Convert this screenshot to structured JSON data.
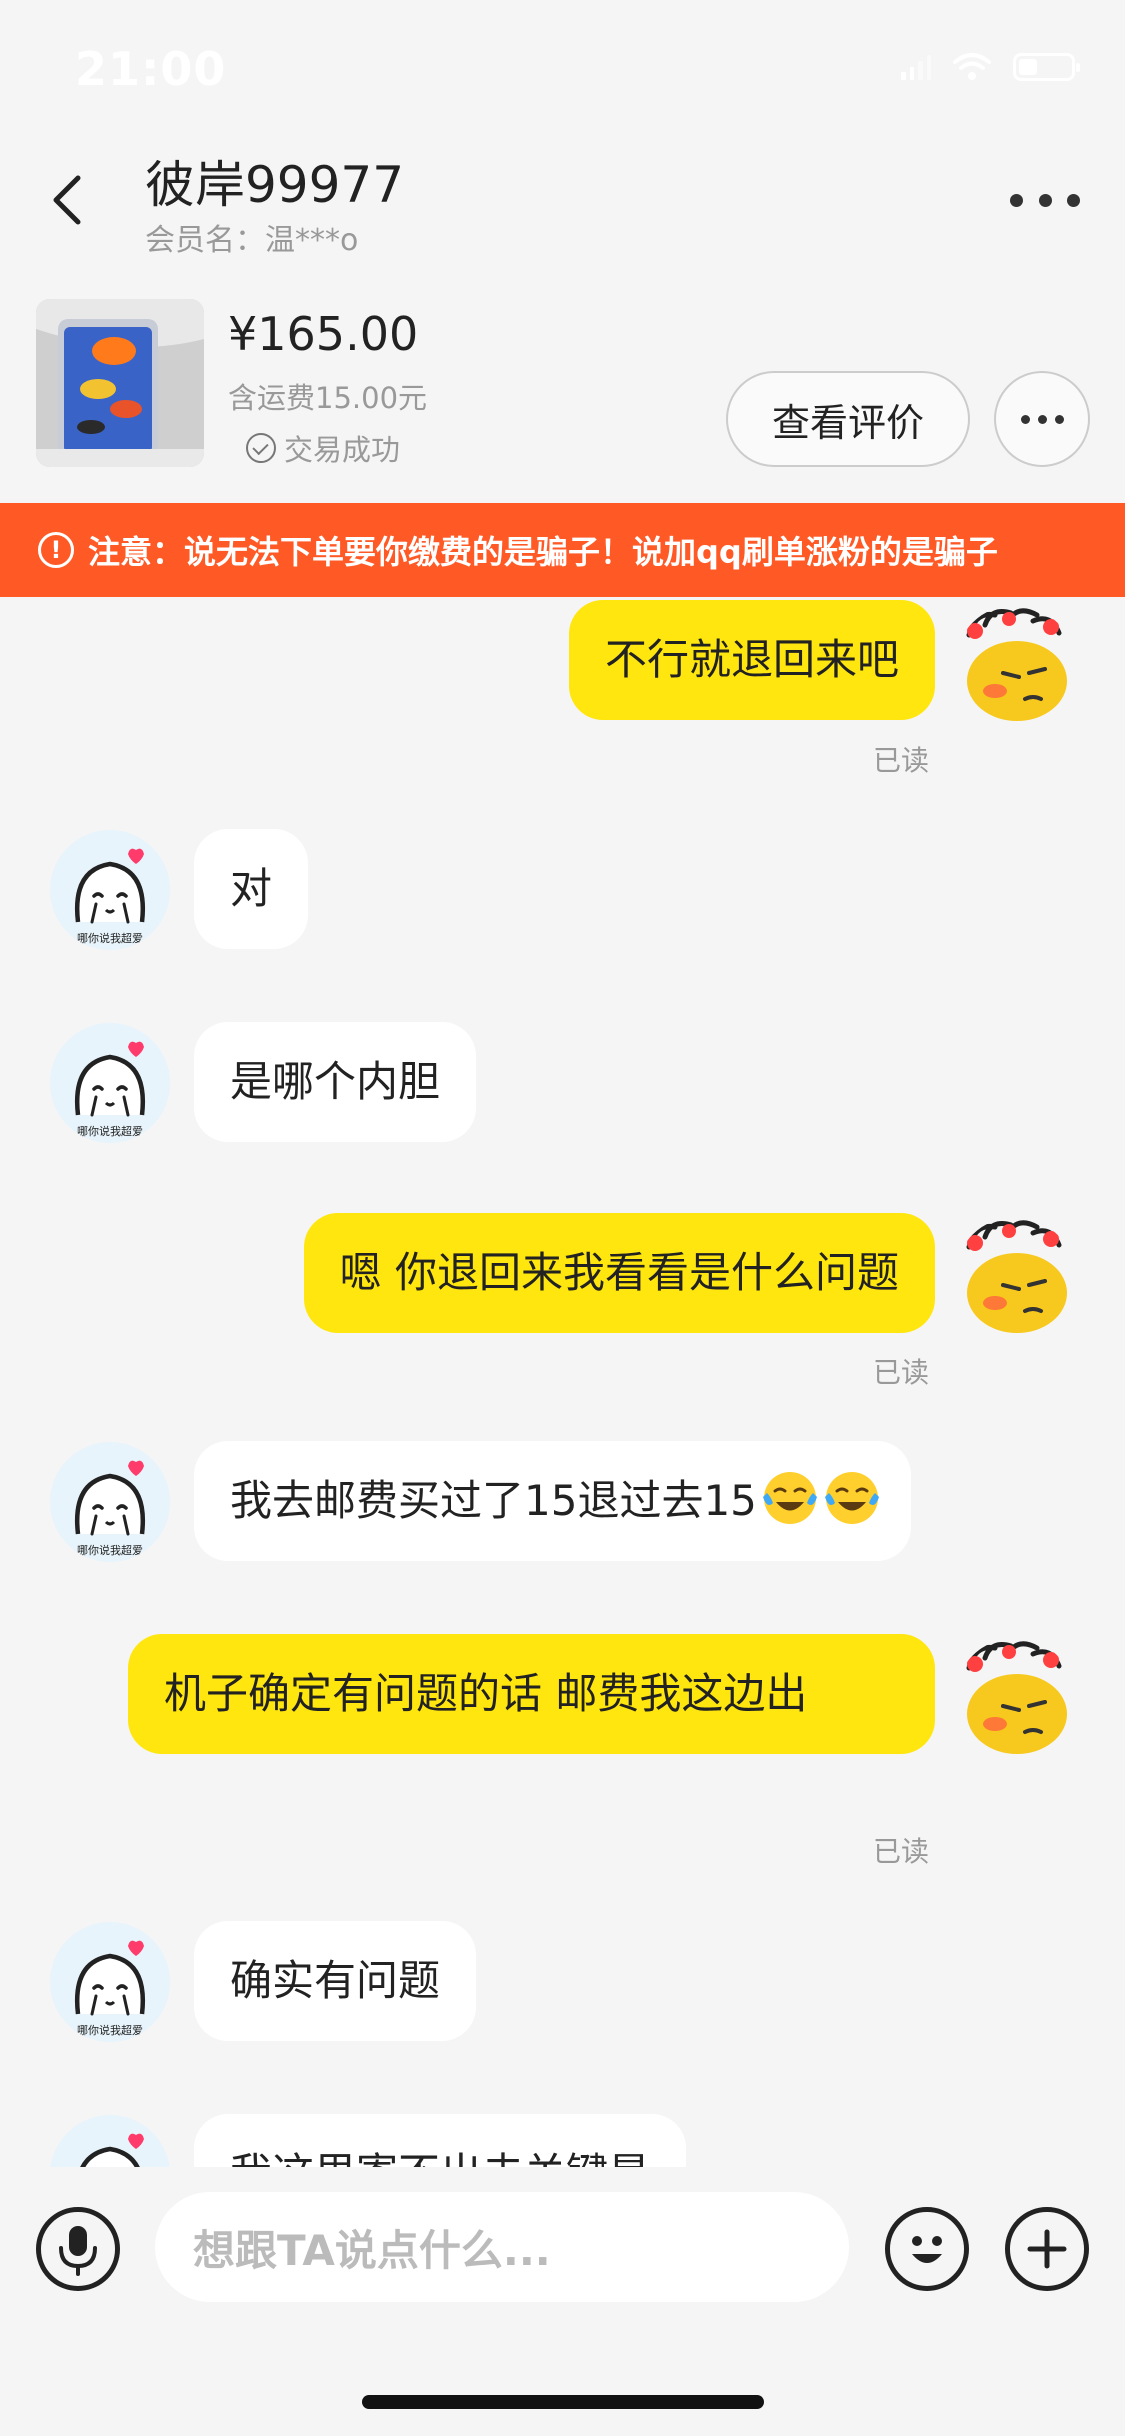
{
  "status": {
    "time": "21:00"
  },
  "header": {
    "nickname": "彼岸99977",
    "member_label": "会员名：温***o"
  },
  "product": {
    "price": "¥165.00",
    "shipping": "含运费15.00元",
    "status": "交易成功",
    "review_button": "查看评价"
  },
  "warning": {
    "text": "注意：说无法下单要你缴费的是骗子！说加qq刷单涨粉的是骗子"
  },
  "messages": [
    {
      "side": "me",
      "text": "不行就退回来吧",
      "read": "已读"
    },
    {
      "side": "them",
      "text": "对"
    },
    {
      "side": "them",
      "text": "是哪个内胆"
    },
    {
      "side": "me",
      "text": "嗯 你退回来我看看是什么问题",
      "read": "已读"
    },
    {
      "side": "them",
      "text": "我去邮费买过了15退过去15"
    },
    {
      "side": "me",
      "text": "机子确定有问题的话 邮费我这边出",
      "read": "已读"
    },
    {
      "side": "them",
      "text": "确实有问题"
    },
    {
      "side": "them",
      "text": "我这里寄不出去关键是"
    }
  ],
  "avatar_caption": "哪你说我超爱",
  "input": {
    "placeholder": "想跟TA说点什么..."
  },
  "colors": {
    "my_bubble": "#ffe60f",
    "their_bubble": "#ffffff",
    "warning": "#ff5a26"
  }
}
